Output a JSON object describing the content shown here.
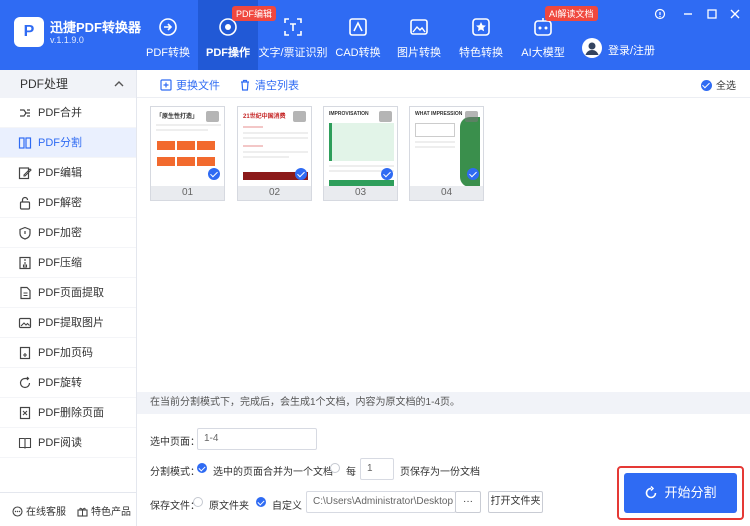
{
  "app": {
    "logo_letter": "P",
    "name": "迅捷PDF转换器",
    "version": "v.1.1.9.0"
  },
  "nav": [
    {
      "label": "PDF转换",
      "icon": "pdf-convert-icon",
      "badge": ""
    },
    {
      "label": "PDF操作",
      "icon": "pdf-operate-icon",
      "badge": "PDF编辑"
    },
    {
      "label": "文字/票证识别",
      "icon": "ocr-icon",
      "badge": ""
    },
    {
      "label": "CAD转换",
      "icon": "cad-icon",
      "badge": ""
    },
    {
      "label": "图片转换",
      "icon": "image-icon",
      "badge": ""
    },
    {
      "label": "特色转换",
      "icon": "star-icon",
      "badge": ""
    },
    {
      "label": "AI大模型",
      "icon": "ai-icon",
      "badge": "AI解读文档"
    }
  ],
  "account": {
    "login_label": "登录/注册"
  },
  "sidebar": {
    "title": "PDF处理",
    "items": [
      {
        "label": "PDF合并",
        "icon": "merge-icon"
      },
      {
        "label": "PDF分割",
        "icon": "split-icon"
      },
      {
        "label": "PDF编辑",
        "icon": "edit-icon"
      },
      {
        "label": "PDF解密",
        "icon": "unlock-icon"
      },
      {
        "label": "PDF加密",
        "icon": "shield-icon"
      },
      {
        "label": "PDF压缩",
        "icon": "compress-icon"
      },
      {
        "label": "PDF页面提取",
        "icon": "page-extract-icon"
      },
      {
        "label": "PDF提取图片",
        "icon": "image-extract-icon"
      },
      {
        "label": "PDF加页码",
        "icon": "page-number-icon"
      },
      {
        "label": "PDF旋转",
        "icon": "rotate-icon"
      },
      {
        "label": "PDF删除页面",
        "icon": "delete-page-icon"
      },
      {
        "label": "PDF阅读",
        "icon": "book-icon"
      }
    ],
    "active_index": 1,
    "footer": {
      "service": "在线客服",
      "featured": "特色产品"
    }
  },
  "toolbar": {
    "replace_file": "更换文件",
    "clear_list": "清空列表",
    "select_all": "全选"
  },
  "pages": [
    {
      "caption": "01",
      "title": "「原生性打造」",
      "accent": "#f26a2e"
    },
    {
      "caption": "02",
      "title": "21世纪中国消费",
      "accent": "#c62828"
    },
    {
      "caption": "03",
      "title": "IMPROVISATION",
      "accent": "#2e9e5b"
    },
    {
      "caption": "04",
      "title": "WHAT IMPRESSION",
      "accent": "#3a8f4c"
    }
  ],
  "info_text": "在当前分割模式下，完成后，会生成1个文档，内容为原文档的1-4页。",
  "form": {
    "pages_label": "选中页面：",
    "pages_value": "1-4",
    "mode_label": "分割模式：",
    "mode_option1": "选中的页面合并为一个文档",
    "mode_option2_prefix": "每",
    "mode_option2_value": "1",
    "mode_option2_suffix": "页保存为一份文档",
    "save_label": "保存文件：",
    "save_option_original": "原文件夹",
    "save_option_custom": "自定义",
    "save_path": "C:\\Users\\Administrator\\Desktop",
    "browse": "···",
    "open_folder": "打开文件夹"
  },
  "start_button": "开始分割",
  "colors": {
    "primary": "#2f6bf3",
    "badge": "#f0483e",
    "highlight": "#e53935"
  }
}
